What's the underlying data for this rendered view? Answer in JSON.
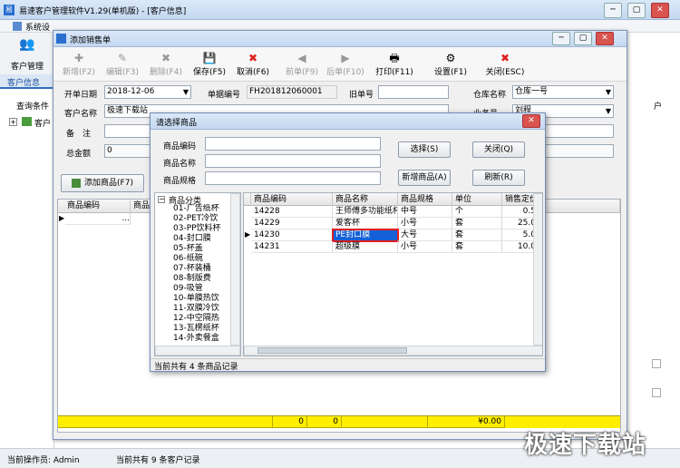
{
  "main": {
    "title": "易速客户管理软件V1.29(单机版) - [客户信息]",
    "menu_first": "系统设",
    "left_label": "客户管理",
    "tab_label": "客户信息",
    "query_label": "查询条件",
    "tree_label": "客户",
    "right_label": "户",
    "status_user": "当前操作员: Admin",
    "status_count": "当前共有 9 条客户记录"
  },
  "order": {
    "title": "添加销售单",
    "toolbar": [
      {
        "label": "新增(F2)",
        "icon": "plus-icon",
        "enabled": false
      },
      {
        "label": "编辑(F3)",
        "icon": "edit-icon",
        "enabled": false
      },
      {
        "label": "删除(F4)",
        "icon": "delete-icon",
        "enabled": false
      },
      {
        "label": "保存(F5)",
        "icon": "save-icon",
        "enabled": true
      },
      {
        "label": "取消(F6)",
        "icon": "cancel-icon",
        "enabled": true
      },
      {
        "label": "前单(F9)",
        "icon": "prev-icon",
        "enabled": false
      },
      {
        "label": "后单(F10)",
        "icon": "next-icon",
        "enabled": false
      },
      {
        "label": "打印(F11)",
        "icon": "print-icon",
        "enabled": true
      },
      {
        "label": "设置(F1)",
        "icon": "settings-icon",
        "enabled": true
      },
      {
        "label": "关闭(ESC)",
        "icon": "close-icon",
        "enabled": true
      }
    ],
    "date_label": "开单日期",
    "date_value": "2018-12-06",
    "number_label": "单据编号",
    "number_value": "FH201812060001",
    "old_label": "旧单号",
    "old_value": "",
    "warehouse_label": "仓库名称",
    "warehouse_value": "仓库一号",
    "customer_label": "客户名称",
    "customer_value": "极速下载站",
    "staff_label": "业务员",
    "staff_value": "刘程",
    "remark_label": "备　注",
    "total_label": "总金额",
    "total_value": "0",
    "add_button": "添加商品(F7)",
    "grid_headers": [
      "商品编码",
      "商品"
    ],
    "grid_row_first": "...",
    "footer_values": [
      "0",
      "0",
      "¥0.00"
    ]
  },
  "dialog": {
    "title": "请选择商品",
    "code_label": "商品编码",
    "name_label": "商品名称",
    "spec_label": "商品规格",
    "select_button": "选择(S)",
    "close_button": "关闭(Q)",
    "new_button": "新增商品(A)",
    "refresh_button": "刷新(R)",
    "tree_root": "商品分类",
    "categories": [
      "01-广告纸杯",
      "02-PET冷饮",
      "03-PP饮料杯",
      "04-封口膜",
      "05-杯盖",
      "06-纸碗",
      "07-杯装桶",
      "08-制版费",
      "09-吸管",
      "10-单膜热饮",
      "11-双膜冷饮",
      "12-中空隔热",
      "13-瓦楞纸杯",
      "14-外卖餐盒"
    ],
    "headers": [
      "商品编码",
      "商品名称",
      "商品规格",
      "单位",
      "销售定价"
    ],
    "rows": [
      [
        "14228",
        "王师傅多功能纸杯",
        "中号",
        "个",
        "0.5"
      ],
      [
        "14229",
        "爱客杯",
        "小号",
        "套",
        "25.0"
      ],
      [
        "14230",
        "PE封口膜",
        "大号",
        "套",
        "5.0"
      ],
      [
        "14231",
        "超级膜",
        "小号",
        "套",
        "10.0"
      ]
    ],
    "status": "当前共有 4 条商品记录"
  },
  "watermark": "极速下载站"
}
